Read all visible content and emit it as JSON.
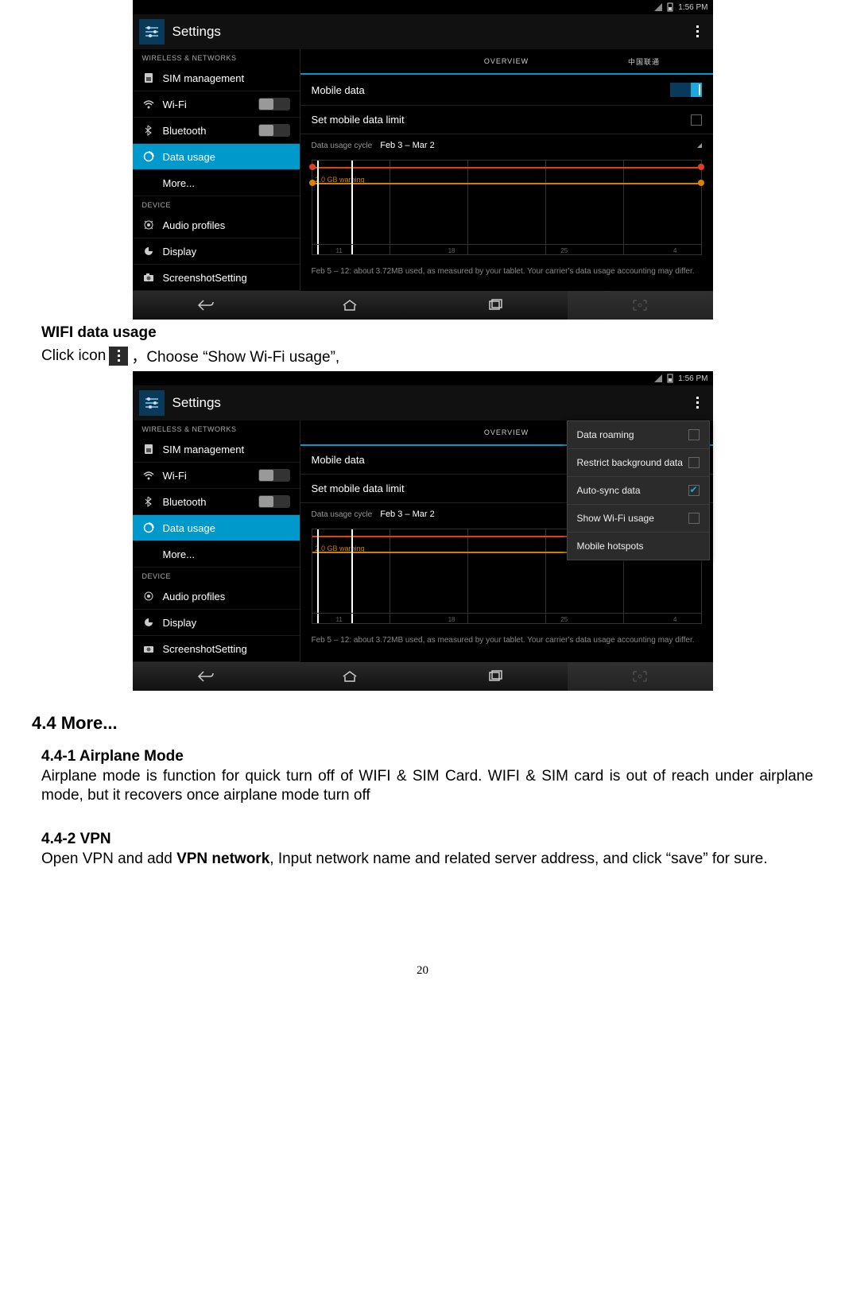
{
  "status": {
    "time": "1:56 PM"
  },
  "header": {
    "title": "Settings"
  },
  "sidebar": {
    "section_wireless": "WIRELESS & NETWORKS",
    "sim": "SIM management",
    "wifi": "Wi-Fi",
    "bluetooth": "Bluetooth",
    "data_usage": "Data usage",
    "more": "More...",
    "section_device": "DEVICE",
    "audio": "Audio profiles",
    "display": "Display",
    "screenshot": "ScreenshotSetting"
  },
  "tabs": {
    "overview": "OVERVIEW",
    "carrier": "中国联通"
  },
  "content": {
    "mobile_data": "Mobile data",
    "set_limit": "Set mobile data limit",
    "cycle_label": "Data usage cycle",
    "cycle_value": "Feb 3 – Mar 2",
    "usage_note": "Feb 5 – 12: about 3.72MB used, as measured by your tablet. Your carrier's data usage accounting may differ."
  },
  "chart_data": {
    "type": "line",
    "title": "",
    "x_range": [
      "Feb 3",
      "Mar 2"
    ],
    "month_ticks": [
      "11",
      "18",
      "25",
      "4"
    ],
    "warning_gb": 2.0,
    "warning_label": "2.0 GB\nwarning",
    "limit_line_present": true,
    "selection": [
      "Feb 5",
      "Feb 12"
    ],
    "usage_mb": 3.72
  },
  "popup": {
    "items": [
      {
        "label": "Data roaming",
        "checked": false,
        "checkbox": true
      },
      {
        "label": "Restrict background data",
        "checked": false,
        "checkbox": true
      },
      {
        "label": "Auto-sync data",
        "checked": true,
        "checkbox": true
      },
      {
        "label": "Show Wi-Fi usage",
        "checked": false,
        "checkbox": true
      },
      {
        "label": "Mobile hotspots",
        "checked": false,
        "checkbox": false
      }
    ]
  },
  "doc": {
    "wifi_heading": "WIFI data usage",
    "click_icon_pre": "Click icon",
    "click_icon_post": "，Choose “Show Wi-Fi usage”,",
    "sec44": "4.4 More...",
    "sec441_h": "4.4-1 Airplane Mode",
    "sec441_b": "Airplane mode is function for quick turn off of WIFI & SIM Card. WIFI & SIM card is out of reach under airplane mode, but it recovers once airplane mode turn off",
    "sec442_h": "4.4-2 VPN",
    "sec442_b_pre": "Open VPN and add ",
    "sec442_b_bold": "VPN network",
    "sec442_b_post": ", Input network name and related server address, and click “save” for sure.",
    "page_number": "20"
  }
}
